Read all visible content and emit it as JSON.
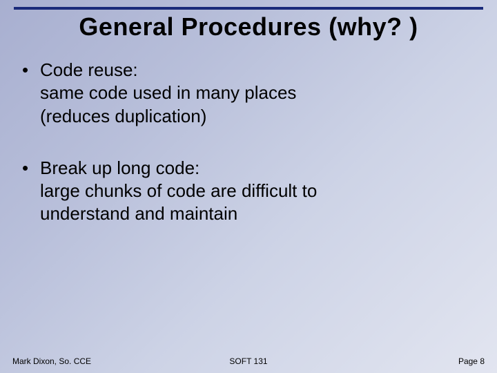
{
  "title": "General Procedures (why? )",
  "bullets": [
    {
      "head": "Code reuse:",
      "lines": [
        "same code used in many places",
        " (reduces duplication)"
      ]
    },
    {
      "head": "Break up long code:",
      "lines": [
        "large chunks of code are difficult to",
        "understand and maintain"
      ]
    }
  ],
  "footer": {
    "left": "Mark Dixon, So. CCE",
    "center": "SOFT 131",
    "right": "Page 8"
  }
}
